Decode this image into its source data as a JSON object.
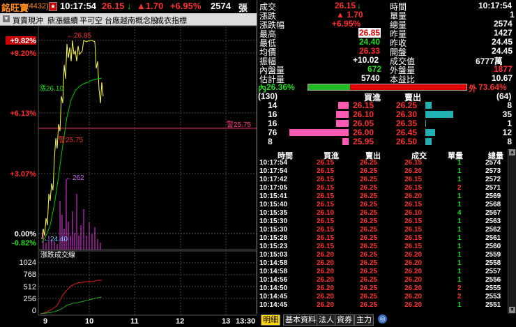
{
  "header": {
    "stock_name": "銘旺實",
    "stock_code": "(4432)",
    "flag": "CN",
    "time": "10:17:54",
    "price": "26.15",
    "price_arrow": "↓",
    "change": "▲1.70",
    "change_pct": "+6.95%",
    "volume": "2574",
    "volume_unit": "張"
  },
  "tags": [
    "買賣現沖",
    "鼎漲繼續",
    "平可空",
    "台廠越南概念股",
    "成衣指標"
  ],
  "chart": {
    "pct_labels": [
      "+9.82%",
      "+9.20%",
      "+6.13%",
      "+3.07%",
      "0.00%",
      "-0.82%"
    ],
    "annotations": {
      "high": "26.85",
      "left_mark": "漲26.10",
      "ref_line": "警25.75",
      "mid_price": "警25.75",
      "vol_peak": "262",
      "low": "24.40"
    },
    "xaxis": [
      "9",
      "10",
      "11",
      "12",
      "13",
      "13:30"
    ],
    "subpanel_title": "漲跌成交線",
    "subpanel_ticks": [
      "1024",
      "768",
      "512",
      "256",
      "0"
    ],
    "colors": {
      "price": "#ffff30",
      "avg": "#00cc00",
      "volume": "#ff30ff",
      "ref": "#ff2080"
    }
  },
  "quote": {
    "rows_left": [
      {
        "label": "成交",
        "value": "26.15",
        "cls": "red",
        "arrow": "↓"
      },
      {
        "label": "漲跌",
        "value": "▲ 1.70",
        "cls": "red"
      },
      {
        "label": "漲跌幅",
        "value": "+6.95%",
        "cls": "red"
      },
      {
        "label": "最高",
        "value": "26.85",
        "cls": "hl"
      },
      {
        "label": "最低",
        "value": "24.40",
        "cls": "green"
      },
      {
        "label": "均價",
        "value": "26.33",
        "cls": "red"
      },
      {
        "label": "振幅",
        "value": "+10.02",
        "cls": "white"
      },
      {
        "label": "內盤量",
        "value": "672",
        "cls": "green"
      },
      {
        "label": "估計量",
        "value": "5740",
        "cls": "white"
      }
    ],
    "rows_right": [
      {
        "label": "時間",
        "value": "10:17:54",
        "cls": "white"
      },
      {
        "label": "單量",
        "value": "1",
        "cls": "white"
      },
      {
        "label": "總量",
        "value": "2574",
        "cls": "white"
      },
      {
        "label": "昨量",
        "value": "1427",
        "cls": "white"
      },
      {
        "label": "昨收",
        "value": "24.45",
        "cls": "white"
      },
      {
        "label": "開盤",
        "value": "24.45",
        "cls": "white"
      },
      {
        "label": "成交值",
        "value": "6777萬",
        "cls": "white"
      },
      {
        "label": "外盤量",
        "value": "1877",
        "cls": "red"
      },
      {
        "label": "本益比",
        "value": "10.67",
        "cls": "white"
      }
    ],
    "inner_label": "內",
    "inner_pct": "26.36%",
    "outer_label": "外",
    "outer_pct": "73.64%",
    "inner_ratio": 0.2636
  },
  "orderbook": {
    "left_total": "(130)",
    "right_total": "(64)",
    "bid_header": "買進",
    "ask_header": "賣出",
    "rows": [
      {
        "bid_qty": "14",
        "bid": "26.15",
        "ask": "26.25",
        "ask_qty": "8",
        "bid_frac": 0.18,
        "ask_frac": 0.23
      },
      {
        "bid_qty": "16",
        "bid": "26.10",
        "ask": "26.30",
        "ask_qty": "35",
        "bid_frac": 0.21,
        "ask_frac": 1.0
      },
      {
        "bid_qty": "16",
        "bid": "26.05",
        "ask": "26.35",
        "ask_qty": "1",
        "bid_frac": 0.21,
        "ask_frac": 0.03
      },
      {
        "bid_qty": "76",
        "bid": "26.00",
        "ask": "26.45",
        "ask_qty": "12",
        "bid_frac": 1.0,
        "ask_frac": 0.34
      },
      {
        "bid_qty": "8",
        "bid": "25.95",
        "ask": "26.50",
        "ask_qty": "8",
        "bid_frac": 0.11,
        "ask_frac": 0.23
      }
    ]
  },
  "ticks": {
    "headers": [
      "時間",
      "買進",
      "賣出",
      "成交",
      "單量",
      "總量"
    ],
    "rows": [
      [
        "10:17:54",
        "26.15",
        "26.25",
        "26.15",
        "1",
        "2574"
      ],
      [
        "10:17:54",
        "26.15",
        "26.25",
        "26.20",
        "1",
        "2573"
      ],
      [
        "10:17:42",
        "26.15",
        "26.25",
        "26.15",
        "1",
        "2572"
      ],
      [
        "10:17:05",
        "26.15",
        "26.25",
        "26.15",
        "2",
        "2571"
      ],
      [
        "10:15:41",
        "26.15",
        "26.25",
        "26.20",
        "1",
        "2569"
      ],
      [
        "10:15:40",
        "26.15",
        "26.25",
        "26.15",
        "1",
        "2568"
      ],
      [
        "10:15:35",
        "26.10",
        "26.25",
        "26.10",
        "4",
        "2567"
      ],
      [
        "10:15:30",
        "26.15",
        "26.25",
        "26.15",
        "1",
        "2563"
      ],
      [
        "10:15:30",
        "26.15",
        "26.25",
        "26.15",
        "1",
        "2562"
      ],
      [
        "10:15:28",
        "26.15",
        "26.25",
        "26.15",
        "1",
        "2561"
      ],
      [
        "10:15:23",
        "26.15",
        "26.25",
        "26.15",
        "1",
        "2560"
      ],
      [
        "10:15:03",
        "26.20",
        "26.25",
        "26.20",
        "1",
        "2559"
      ],
      [
        "10:14:58",
        "26.20",
        "26.25",
        "26.20",
        "1",
        "2558"
      ],
      [
        "10:14:58",
        "26.20",
        "26.25",
        "26.20",
        "1",
        "2557"
      ],
      [
        "10:14:56",
        "26.20",
        "26.25",
        "26.20",
        "1",
        "2556"
      ],
      [
        "10:14:50",
        "26.20",
        "26.25",
        "26.20",
        "2",
        "2555"
      ],
      [
        "10:14:45",
        "26.20",
        "26.25",
        "26.20",
        "2",
        "2553"
      ],
      [
        "10:14:45",
        "26.20",
        "26.25",
        "26.20",
        "1",
        "2551"
      ]
    ],
    "row_colors": [
      "#fff",
      "#ff3030",
      "#ff3030",
      "#ff3030",
      "#22dd22",
      "#fff"
    ]
  },
  "tabs": [
    "明細",
    "基本資料",
    "法人",
    "資券",
    "主力"
  ],
  "active_tab": "明細"
}
